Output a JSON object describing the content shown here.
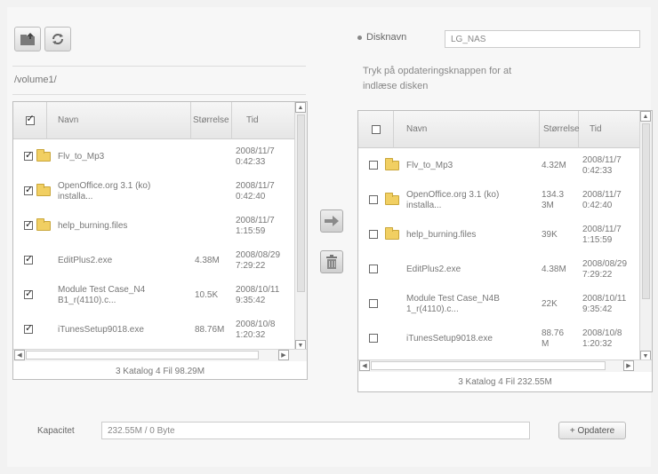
{
  "toolbar": {
    "upload_icon": "folder-up-icon",
    "refresh_icon": "refresh-icon"
  },
  "left": {
    "path": "/volume1/",
    "columns": {
      "name": "Navn",
      "size": "Størrelse",
      "time": "Tid"
    },
    "rows": [
      {
        "checked": true,
        "folder": true,
        "name": "Flv_to_Mp3",
        "size": "",
        "time": "2008/11/7\n0:42:33"
      },
      {
        "checked": true,
        "folder": true,
        "name": "OpenOffice.org 3.1 (ko)\ninstalla...",
        "size": "",
        "time": "2008/11/7\n0:42:40"
      },
      {
        "checked": true,
        "folder": true,
        "name": "help_burning.files",
        "size": "",
        "time": "2008/11/7\n1:15:59"
      },
      {
        "checked": true,
        "folder": false,
        "name": "EditPlus2.exe",
        "size": "4.38M",
        "time": "2008/08/29\n7:29:22"
      },
      {
        "checked": true,
        "folder": false,
        "name": "Module Test Case_N4\nB1_r(4110).c...",
        "size": "10.5K",
        "time": "2008/10/11\n9:35:42"
      },
      {
        "checked": true,
        "folder": false,
        "name": "iTunesSetup9018.exe",
        "size": "88.76M",
        "time": "2008/10/8\n1:20:32"
      }
    ],
    "footer": "3 Katalog   4 Fil   98.29M"
  },
  "right": {
    "disc_label": "Disknavn",
    "disc_value": "LG_NAS",
    "hint": "Tryk på opdateringsknappen for at\nindlæse disken",
    "columns": {
      "name": "Navn",
      "size": "Størrelse",
      "time": "Tid"
    },
    "rows": [
      {
        "checked": false,
        "folder": true,
        "name": "Flv_to_Mp3",
        "size": "4.32M",
        "time": "2008/11/7\n0:42:33"
      },
      {
        "checked": false,
        "folder": true,
        "name": "OpenOffice.org 3.1 (ko)\ninstalla...",
        "size": "134.3\n3M",
        "time": "2008/11/7\n0:42:40"
      },
      {
        "checked": false,
        "folder": true,
        "name": "help_burning.files",
        "size": "39K",
        "time": "2008/11/7\n1:15:59"
      },
      {
        "checked": false,
        "folder": false,
        "name": "EditPlus2.exe",
        "size": "4.38M",
        "time": "2008/08/29\n7:29:22"
      },
      {
        "checked": false,
        "folder": false,
        "name": "Module Test Case_N4B\n1_r(4110).c...",
        "size": "22K",
        "time": "2008/10/11\n9:35:42"
      },
      {
        "checked": false,
        "folder": false,
        "name": "iTunesSetup9018.exe",
        "size": "88.76\nM",
        "time": "2008/10/8\n1:20:32"
      }
    ],
    "footer": "3 Katalog   4 Fil   232.55M"
  },
  "actions": {
    "copy_icon": "arrow-right-icon",
    "delete_icon": "trash-icon"
  },
  "capacity": {
    "label": "Kapacitet",
    "value": "232.55M / 0 Byte",
    "update_label": "+ Opdatere"
  },
  "colors": {
    "folder": "#f1cf62",
    "background": "#f7f7f7"
  }
}
